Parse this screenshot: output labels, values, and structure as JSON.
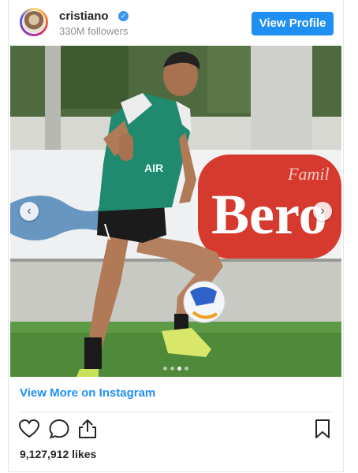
{
  "header": {
    "username": "cristiano",
    "followers": "330M followers",
    "view_profile_label": "View Profile"
  },
  "icons": {
    "verified": "verified-badge-icon",
    "prev": "chevron-left-icon",
    "next": "chevron-right-icon",
    "like": "heart-icon",
    "comment": "comment-icon",
    "share": "share-icon",
    "save": "bookmark-icon"
  },
  "carousel": {
    "prev_glyph": "‹",
    "next_glyph": "›",
    "slide_count": 4,
    "active_slide": 3
  },
  "footer": {
    "view_more_label": "View More on Instagram",
    "likes": "9,127,912 likes"
  },
  "colors": {
    "accent": "#1f8ff2",
    "verified": "#3897f0",
    "jersey": "#1f8a6e"
  }
}
